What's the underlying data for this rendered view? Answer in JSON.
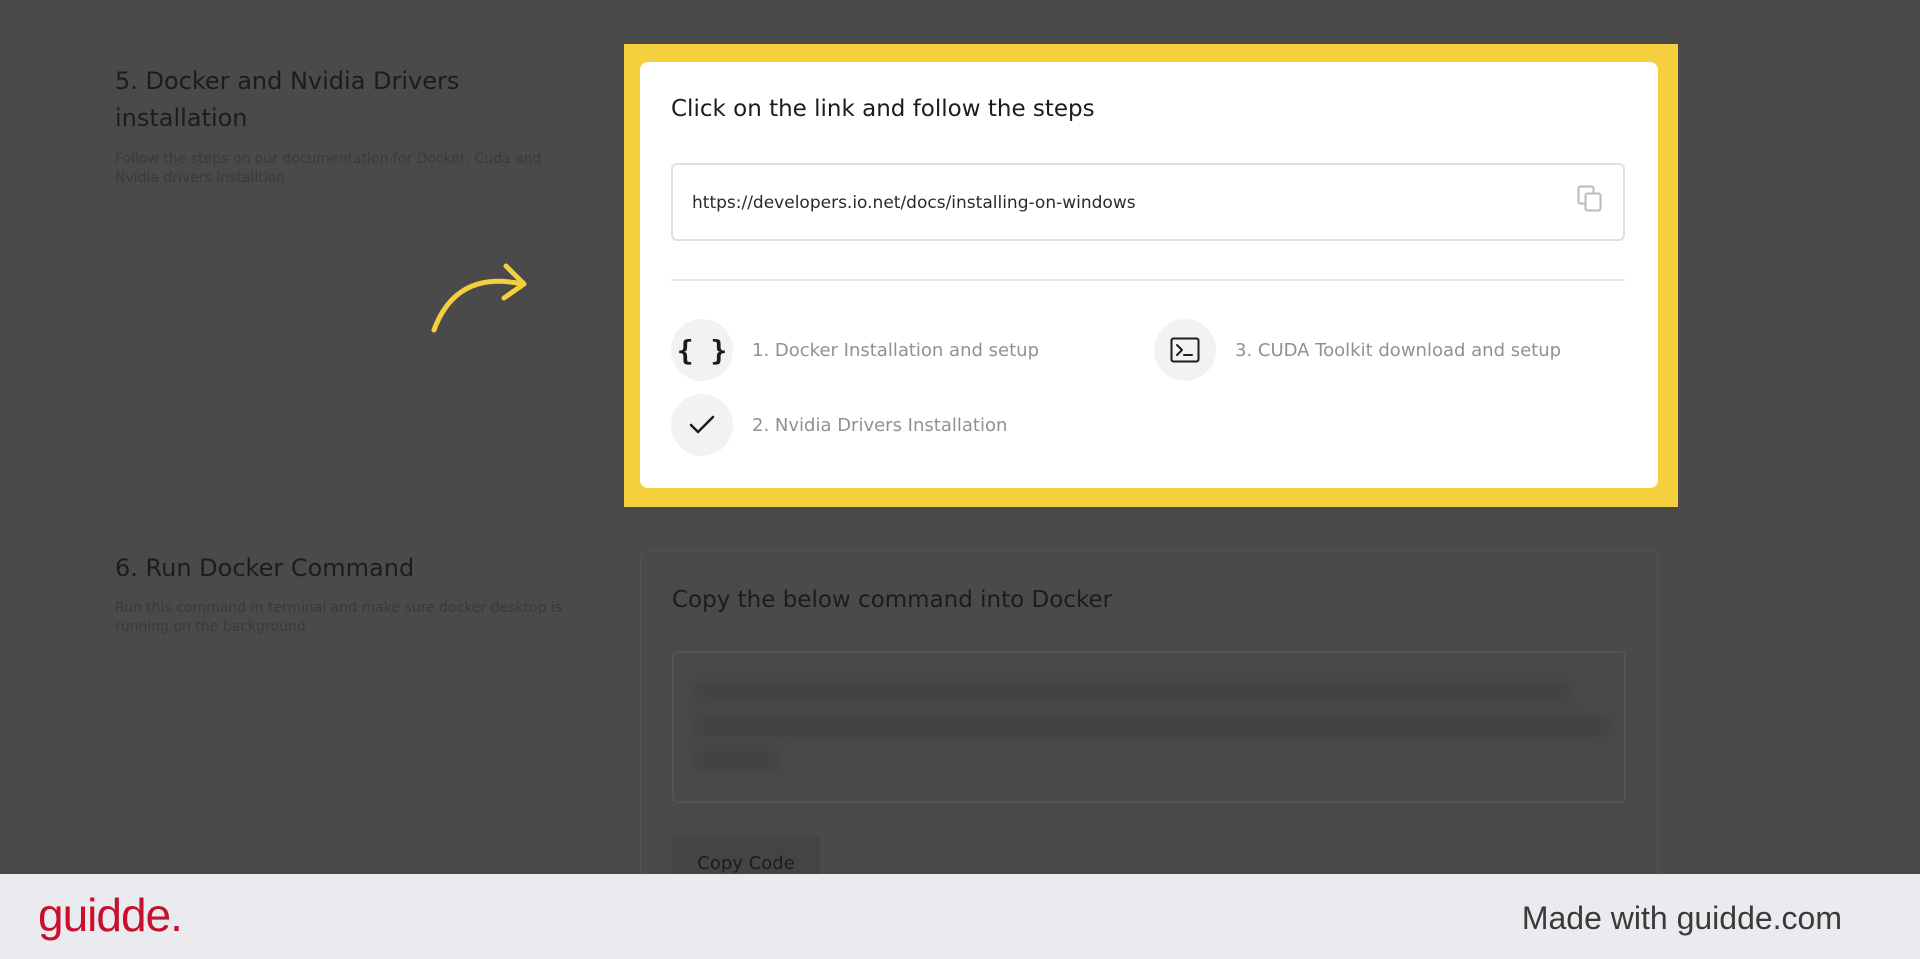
{
  "sections": {
    "docker_drivers": {
      "title_line1": "5. Docker and Nvidia Drivers",
      "title_line2": "installation",
      "desc_line1": "Follow the steps on our documentation for Docker, Cuda and",
      "desc_line2": "Nvidia drivers installtion"
    },
    "run_command": {
      "title": "6. Run Docker Command",
      "desc_line1": "Run this command in terminal and make sure docker desktop is",
      "desc_line2": "running on the background"
    }
  },
  "active_card": {
    "title": "Click on the link and follow the steps",
    "url": "https://developers.io.net/docs/installing-on-windows",
    "steps": [
      {
        "label": "1. Docker Installation and setup",
        "icon": "braces-icon"
      },
      {
        "label": "2. Nvidia Drivers Installation",
        "icon": "check-icon"
      },
      {
        "label": "3. CUDA Toolkit download and setup",
        "icon": "terminal-icon"
      }
    ]
  },
  "dim_card": {
    "title": "Copy the below command into Docker",
    "button_label": "Copy Code"
  },
  "footer": {
    "logo": "guidde.",
    "made_with": "Made with guidde.com"
  },
  "colors": {
    "highlight": "#f4cf3e",
    "overlay": "#4a4a4a",
    "brand": "#c8102e"
  }
}
